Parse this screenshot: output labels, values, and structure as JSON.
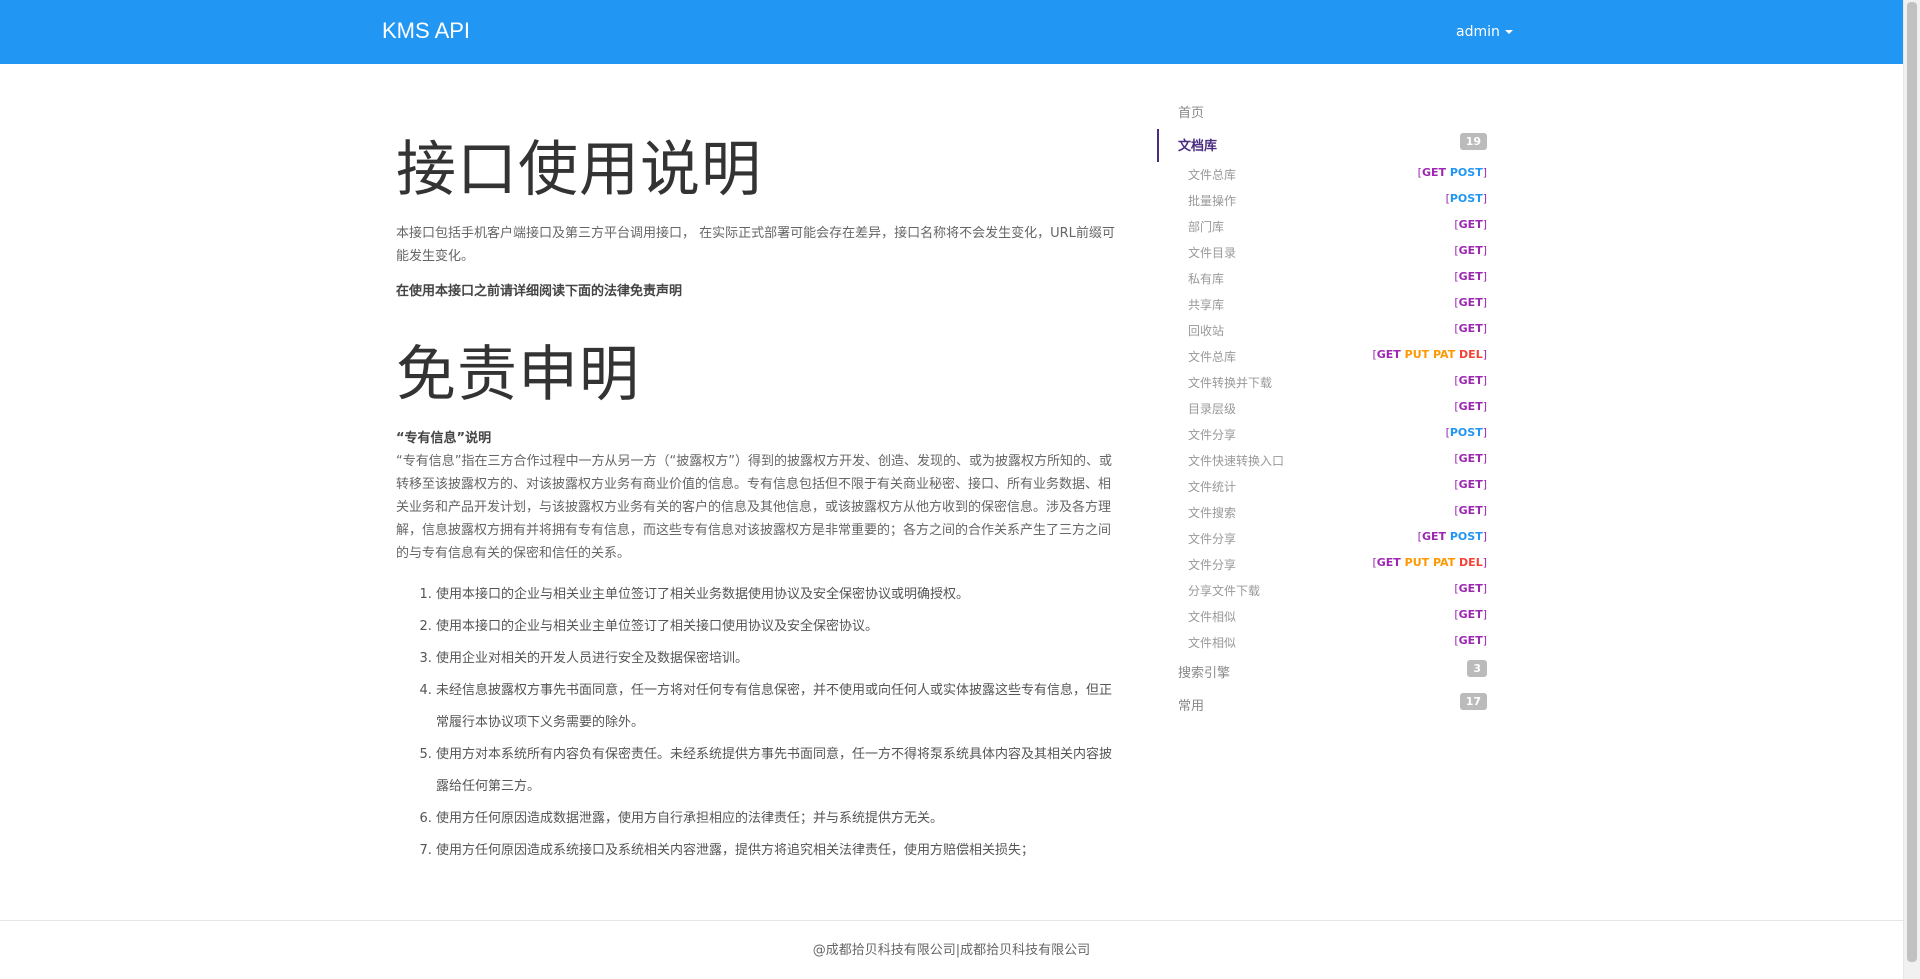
{
  "nav": {
    "brand": "KMS API",
    "user": "admin"
  },
  "content": {
    "title": "接口使用说明",
    "intro": "本接口包括手机客户端接口及第三方平台调用接口， 在实际正式部署可能会存在差异，接口名称将不会发生变化，URL前缀可能发生变化。",
    "notice": "在使用本接口之前请详细阅读下面的法律免责声明",
    "disclaimer_title": "免责申明",
    "subheading": "“专有信息”说明",
    "paragraph": "“专有信息”指在三方合作过程中一方从另一方（“披露权方”）得到的披露权方开发、创造、发现的、或为披露权方所知的、或转移至该披露权方的、对该披露权方业务有商业价值的信息。专有信息包括但不限于有关商业秘密、接口、所有业务数据、相关业务和产品开发计划，与该披露权方业务有关的客户的信息及其他信息，或该披露权方从他方收到的保密信息。涉及各方理解，信息披露权方拥有并将拥有专有信息，而这些专有信息对该披露权方是非常重要的；各方之间的合作关系产生了三方之间的与专有信息有关的保密和信任的关系。",
    "items": [
      "使用本接口的企业与相关业主单位签订了相关业务数据使用协议及安全保密协议或明确授权。",
      "使用本接口的企业与相关业主单位签订了相关接口使用协议及安全保密协议。",
      "使用企业对相关的开发人员进行安全及数据保密培训。",
      "未经信息披露权方事先书面同意，任一方将对任何专有信息保密，并不使用或向任何人或实体披露这些专有信息，但正常履行本协议项下义务需要的除外。",
      "使用方对本系统所有内容负有保密责任。未经系统提供方事先书面同意，任一方不得将泵系统具体内容及其相关内容披露给任何第三方。",
      "使用方任何原因造成数据泄露，使用方自行承担相应的法律责任；并与系统提供方无关。",
      "使用方任何原因造成系统接口及系统相关内容泄露，提供方将追究相关法律责任，使用方赔偿相关损失；"
    ]
  },
  "toc": {
    "home": "首页",
    "library": {
      "label": "文档库",
      "count": "19"
    },
    "endpoints": [
      {
        "label": "文件总库",
        "methods": [
          "GET",
          "POST"
        ]
      },
      {
        "label": "批量操作",
        "methods": [
          "POST"
        ]
      },
      {
        "label": "部门库",
        "methods": [
          "GET"
        ]
      },
      {
        "label": "文件目录",
        "methods": [
          "GET"
        ]
      },
      {
        "label": "私有库",
        "methods": [
          "GET"
        ]
      },
      {
        "label": "共享库",
        "methods": [
          "GET"
        ]
      },
      {
        "label": "回收站",
        "methods": [
          "GET"
        ]
      },
      {
        "label": "文件总库",
        "methods": [
          "GET",
          "PUT",
          "PAT",
          "DEL"
        ]
      },
      {
        "label": "文件转换并下载",
        "methods": [
          "GET"
        ]
      },
      {
        "label": "目录层级",
        "methods": [
          "GET"
        ]
      },
      {
        "label": "文件分享",
        "methods": [
          "POST"
        ]
      },
      {
        "label": "文件快速转换入口",
        "methods": [
          "GET"
        ]
      },
      {
        "label": "文件统计",
        "methods": [
          "GET"
        ]
      },
      {
        "label": "文件搜索",
        "methods": [
          "GET"
        ]
      },
      {
        "label": "文件分享",
        "methods": [
          "GET",
          "POST"
        ]
      },
      {
        "label": "文件分享",
        "methods": [
          "GET",
          "PUT",
          "PAT",
          "DEL"
        ]
      },
      {
        "label": "分享文件下载",
        "methods": [
          "GET"
        ]
      },
      {
        "label": "文件相似",
        "methods": [
          "GET"
        ]
      },
      {
        "label": "文件相似",
        "methods": [
          "GET"
        ]
      }
    ],
    "search": {
      "label": "搜索引擎",
      "count": "3"
    },
    "common": {
      "label": "常用",
      "count": "17"
    }
  },
  "footer": {
    "text": "@成都拾贝科技有限公司|成都拾贝科技有限公司"
  },
  "colors": {
    "navbar": "#2196f3",
    "active": "#4b2c7f",
    "GET": "#9c27b0",
    "POST": "#2196f3",
    "PUT": "#ff9800",
    "PAT": "#ff9800",
    "DEL": "#f44336"
  }
}
